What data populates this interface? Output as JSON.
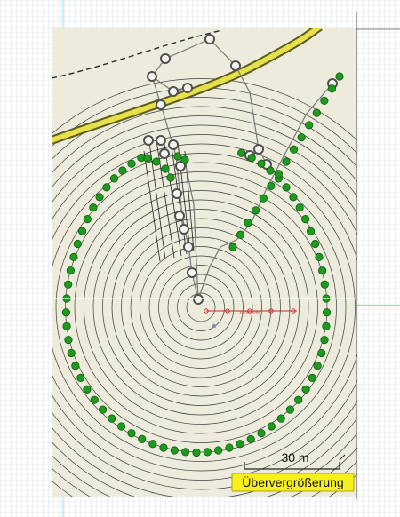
{
  "view": {
    "scale_bar_label": "30 m",
    "exaggeration_label": "Übervergrößerung",
    "measure_label": "10.30 Meter"
  },
  "colors": {
    "grid_bg": "#ffffff",
    "grid_line": "#c8d2dc",
    "map_bg": "#ecebdc",
    "ring": "#3c3c3c",
    "fringe": "#1e1e1e",
    "road_fill": "#e8e04a",
    "road_edge": "#5a5a1e",
    "path": "#787878",
    "green_dot": "#1e9a1e",
    "green_dot_dark": "#0d5e0d",
    "open_marker": "#505050",
    "measure": "#d22323",
    "crosshair": "#ffffff",
    "guide_cyan": "#8ce6f0",
    "guide_red": "#e05a5a",
    "label_bg": "#f5f01e",
    "label_border": "#b4a50a"
  },
  "icons": {
    "green_marker": "filled-green-circle",
    "open_marker": "hollow-circle-marker",
    "measure_node": "hollow-red-circle"
  }
}
